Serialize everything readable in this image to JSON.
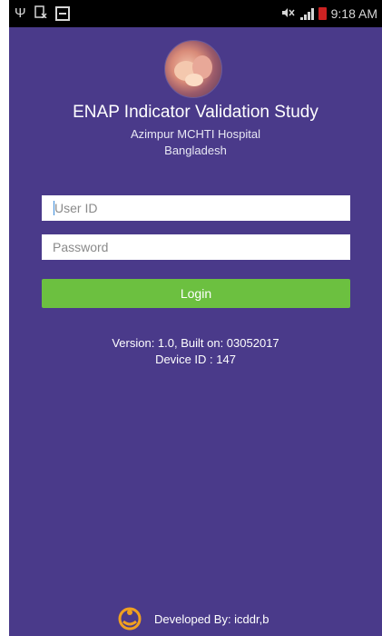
{
  "status_bar": {
    "time": "9:18 AM",
    "icons": [
      "usb-icon",
      "notification-icon",
      "image-icon",
      "mute-icon",
      "signal-icon",
      "battery-icon"
    ]
  },
  "app": {
    "title": "ENAP Indicator Validation Study",
    "hospital": "Azimpur MCHTI Hospital",
    "country": "Bangladesh"
  },
  "form": {
    "user_placeholder": "User ID",
    "password_placeholder": "Password",
    "login_label": "Login"
  },
  "info": {
    "version": "Version: 1.0, Built on: 03052017",
    "device": "Device ID : 147"
  },
  "footer": {
    "developer": "Developed By: icddr,b"
  },
  "colors": {
    "background": "#4a3a8a",
    "button": "#6cc040",
    "status_bar": "#000000"
  }
}
